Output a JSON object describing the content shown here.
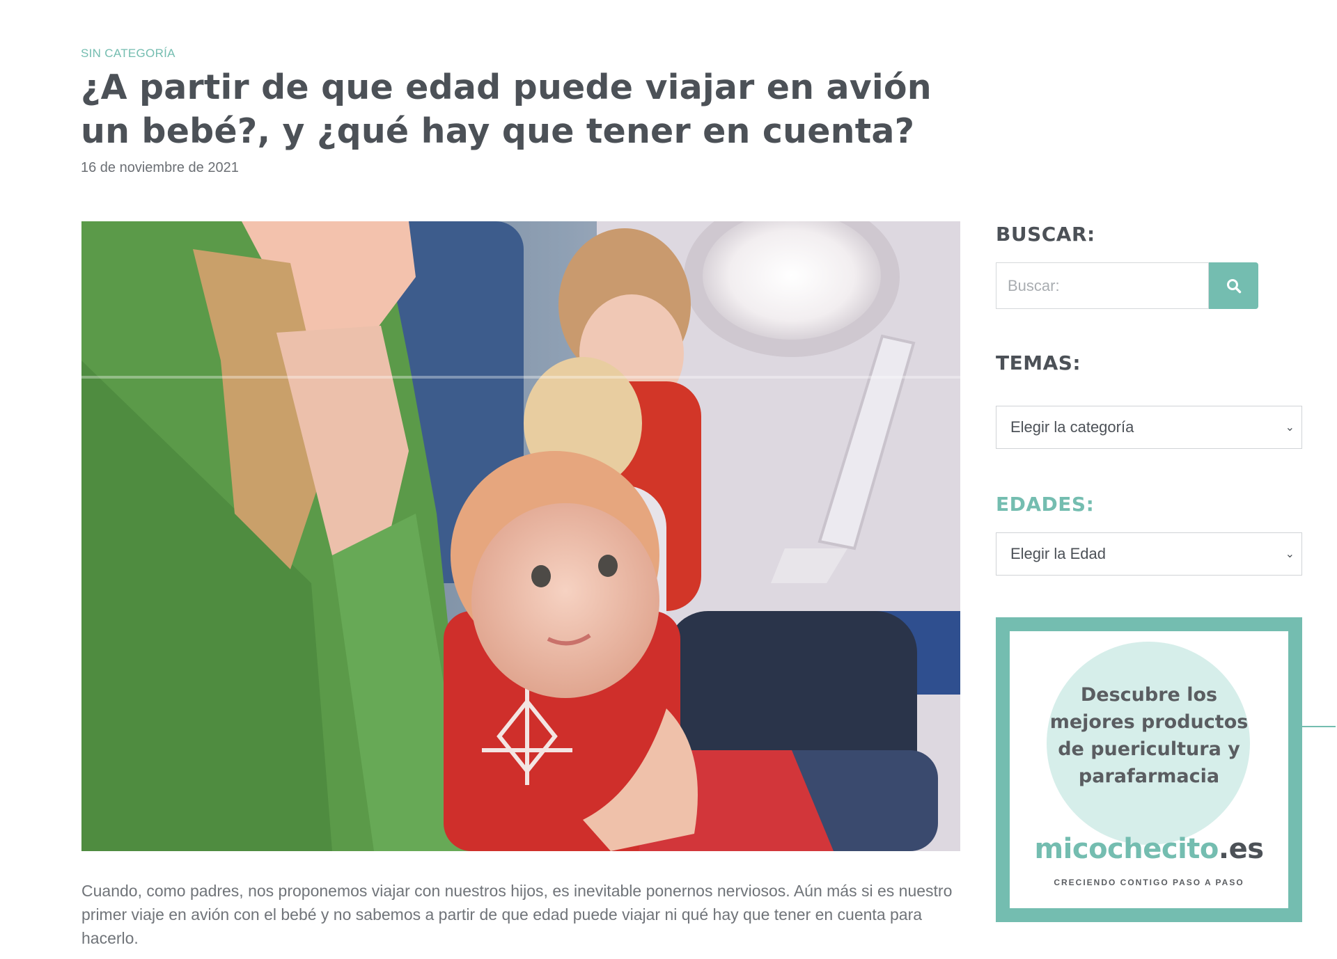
{
  "post": {
    "category": "SIN CATEGORÍA",
    "title": "¿A partir de que edad puede viajar en avión un bebé?, y ¿qué hay que tener en cuenta?",
    "date": "16 de noviembre de 2021",
    "intro": "Cuando, como padres, nos proponemos viajar con nuestros hijos, es inevitable ponernos nerviosos. Aún más si es nuestro primer viaje en avión con el bebé y no sabemos a partir de que edad puede viajar ni qué hay que tener en cuenta para hacerlo."
  },
  "sidebar": {
    "search": {
      "title": "BUSCAR:",
      "placeholder": "Buscar:",
      "button_icon": "search-icon"
    },
    "topics": {
      "title": "TEMAS:",
      "selected": "Elegir la categoría"
    },
    "ages": {
      "title": "EDADES:",
      "selected": "Elegir la Edad"
    },
    "promo": {
      "text": "Descubre los mejores productos de puericultura y parafarmacia",
      "brand_part1": "micochecito",
      "brand_part2": ".es",
      "tagline": "CRECIENDO CONTIGO PASO A PASO"
    }
  },
  "colors": {
    "accent": "#74bdb0",
    "heading": "#4c5157",
    "body_text": "#707479"
  }
}
